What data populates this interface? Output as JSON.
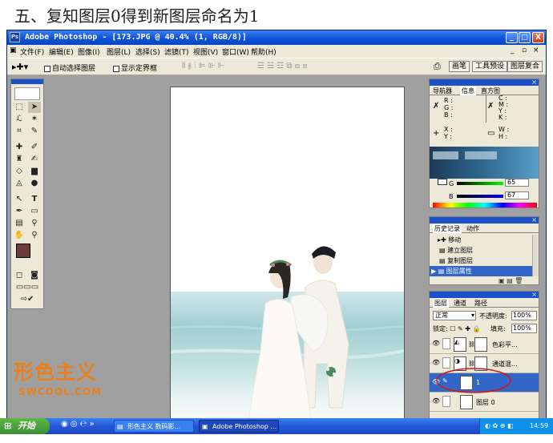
{
  "heading": "五、复知图层0得到新图层命名为1",
  "titlebar": {
    "title": "Adobe Photoshop - [173.JPG @ 40.4% (1, RGB/8)]",
    "min": "_",
    "max": "□",
    "close": "X"
  },
  "menubar": {
    "items": [
      "文件(F)",
      "编辑(E)",
      "图像(I)",
      "图层(L)",
      "选择(S)",
      "滤镜(T)",
      "视图(V)",
      "窗口(W)",
      "帮助(H)"
    ]
  },
  "optionsbar": {
    "auto_select": "自动选择图层",
    "show_bounds": "显示定界框",
    "tabs": [
      "画笔",
      "工具预设",
      "图层复合"
    ]
  },
  "navigator": {
    "tabs": [
      "导航器",
      "信息",
      "直方图"
    ],
    "rgb_labels": [
      "R :",
      "G :",
      "B :"
    ],
    "cmyk_labels": [
      "C :",
      "M :",
      "Y :",
      "K :"
    ],
    "xy_labels": [
      "X :",
      "Y :"
    ],
    "wh_labels": [
      "W :",
      "H :"
    ]
  },
  "color": {
    "g_label": "G",
    "g_value": "65",
    "b_label": "B",
    "b_value": "67"
  },
  "history": {
    "tabs": [
      "历史记录",
      "动作"
    ],
    "items": [
      {
        "label": "移动",
        "selected": false
      },
      {
        "label": "建立图层",
        "selected": false
      },
      {
        "label": "复制图层",
        "selected": false
      },
      {
        "label": "图层属性",
        "selected": true
      }
    ]
  },
  "layers": {
    "tabs": [
      "图层",
      "通道",
      "路径"
    ],
    "blend_mode": "正常",
    "opacity_label": "不透明度:",
    "opacity_value": "100%",
    "lock_label": "锁定:",
    "fill_label": "填充:",
    "fill_value": "100%",
    "items": [
      {
        "name": "色彩平...",
        "selected": false
      },
      {
        "name": "通道混...",
        "selected": false
      },
      {
        "name": "1",
        "selected": true
      },
      {
        "name": "图层 0",
        "selected": false
      }
    ]
  },
  "watermark": {
    "logo": "形色主义",
    "url": "SWCOOL.COM"
  },
  "taskbar": {
    "start": "开始",
    "tasks": [
      "形色主义 数码影...",
      "Adobe Photoshop ..."
    ],
    "clock": "14:59"
  },
  "colors": {
    "title_blue": "#0a50d8",
    "selection_blue": "#3165c6",
    "watermark_orange": "#e9801e",
    "foreground_swatch": "#6e3a3a"
  }
}
